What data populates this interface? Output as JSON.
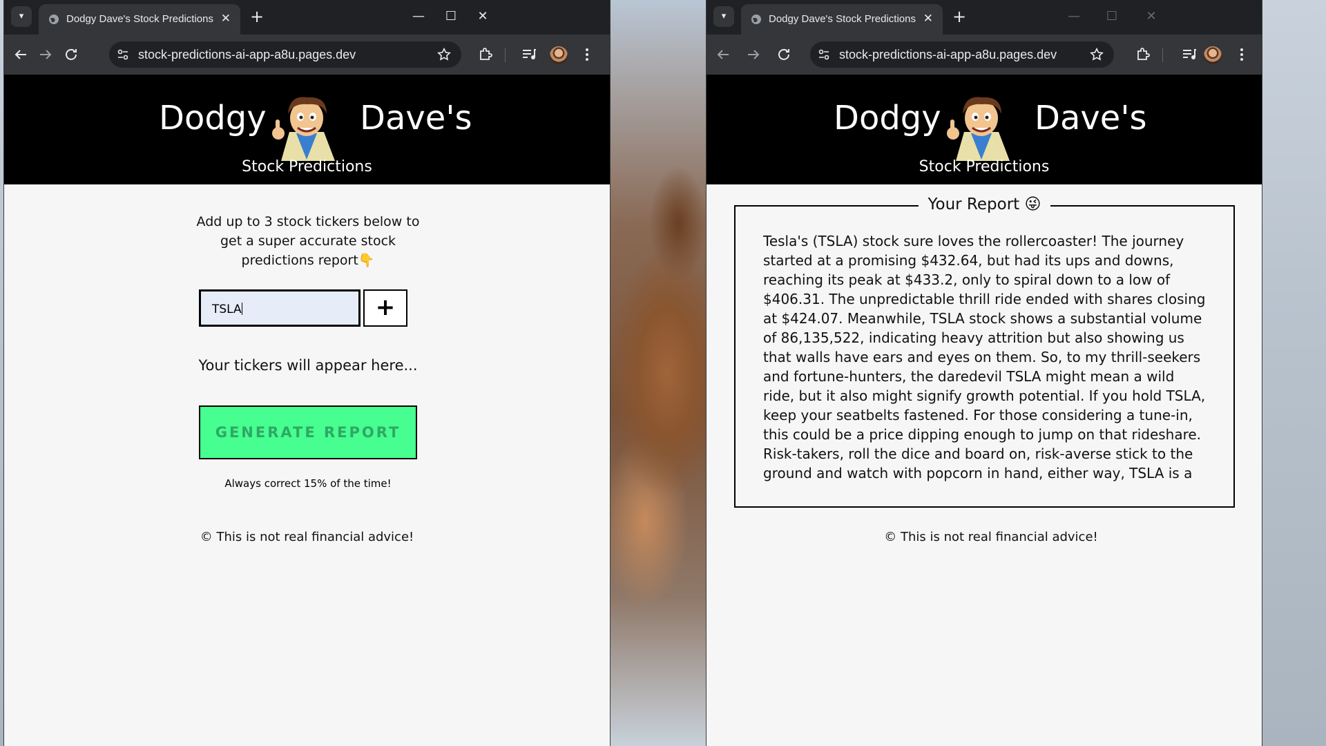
{
  "colors": {
    "header_bg": "#000000",
    "page_bg": "#f6f6f6",
    "generate_bg": "#46ff90",
    "generate_text": "#2fa863",
    "input_bg": "#e7edf8",
    "chrome_tabbar": "#202124",
    "chrome_toolbar": "#35363a"
  },
  "left": {
    "tab_title": "Dodgy Dave's Stock Predictions",
    "url": "stock-predictions-ai-app-a8u.pages.dev",
    "brand_left": "Dodgy",
    "brand_right": "Dave's",
    "subtitle": "Stock Predictions",
    "intro": "Add up to 3 stock tickers below to get a super accurate stock predictions report👇",
    "ticker_value": "TSLA",
    "add_button": "+",
    "tickers_placeholder": "Your tickers will appear here...",
    "generate_label": "GENERATE REPORT",
    "tagline": "Always correct 15% of the time!",
    "footer": "© This is not real financial advice!"
  },
  "right": {
    "tab_title": "Dodgy Dave's Stock Predictions",
    "url": "stock-predictions-ai-app-a8u.pages.dev",
    "brand_left": "Dodgy",
    "brand_right": "Dave's",
    "subtitle": "Stock Predictions",
    "report_title": "Your Report 😜",
    "report_text": "Tesla's (TSLA) stock sure loves the rollercoaster! The journey started at a promising $432.64, but had its ups and downs, reaching its peak at $433.2, only to spiral down to a low of $406.31. The unpredictable thrill ride ended with shares closing at $424.07. Meanwhile, TSLA stock shows a substantial volume of 86,135,522, indicating heavy attrition but also showing us that walls have ears and eyes on them. So, to my thrill-seekers and fortune-hunters, the daredevil TSLA might mean a wild ride, but it also might signify growth potential. If you hold TSLA, keep your seatbelts fastened. For those considering a tune-in, this could be a price dipping enough to jump on that rideshare. Risk-takers, roll the dice and board on, risk-averse stick to the ground and watch with popcorn in hand, either way, TSLA is a",
    "footer": "© This is not real financial advice!"
  },
  "icons": {
    "tab_dropdown": "chevron-down-icon",
    "tab_favicon": "globe-icon",
    "tab_close": "close-icon",
    "new_tab": "plus-icon",
    "minimize": "minimize-icon",
    "maximize": "maximize-icon",
    "close_window": "close-icon",
    "back": "back-arrow-icon",
    "forward": "forward-arrow-icon",
    "reload": "reload-icon",
    "site_info": "site-settings-icon",
    "bookmark": "star-icon",
    "extensions": "puzzle-icon",
    "media": "media-control-icon",
    "profile": "avatar",
    "menu": "kebab-menu-icon"
  }
}
